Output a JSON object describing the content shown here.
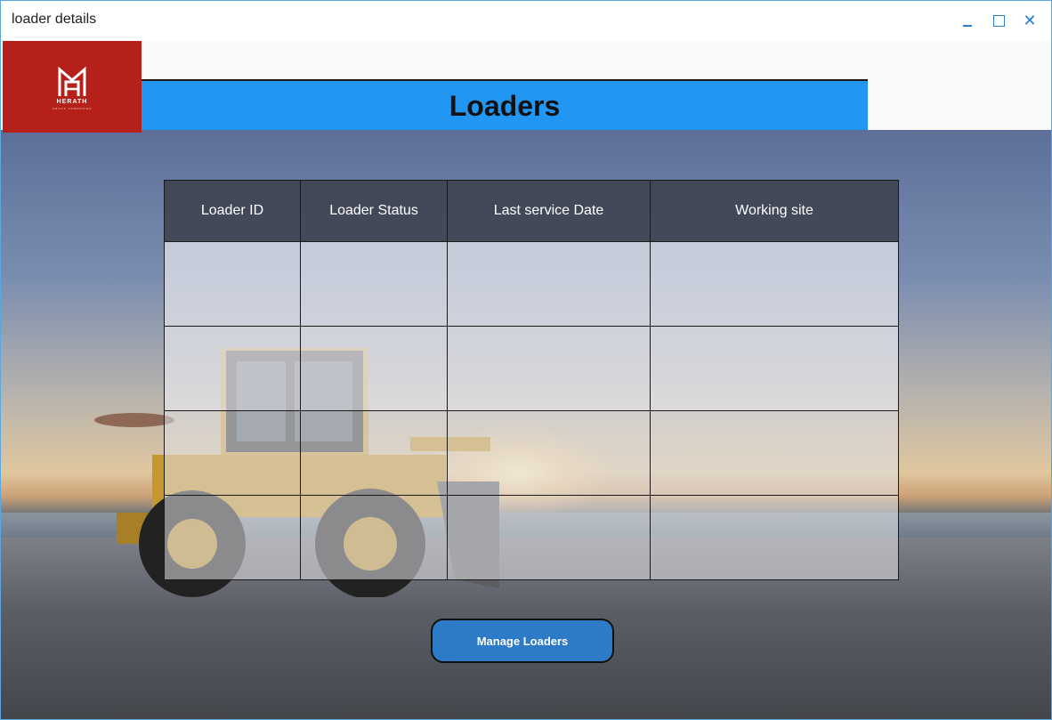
{
  "window": {
    "title": "loader details"
  },
  "logo": {
    "text": "HERATH",
    "subtext": "GROUP COMPANIES"
  },
  "header": {
    "title": "Loaders"
  },
  "table": {
    "columns": [
      "Loader ID",
      "Loader Status",
      "Last service Date",
      "Working site"
    ],
    "rows": [
      [
        "",
        "",
        "",
        ""
      ],
      [
        "",
        "",
        "",
        ""
      ],
      [
        "",
        "",
        "",
        ""
      ],
      [
        "",
        "",
        "",
        ""
      ]
    ]
  },
  "actions": {
    "manage_label": "Manage Loaders"
  },
  "colors": {
    "header_bar": "#2196f3",
    "logo_bg": "#b5201a",
    "button": "#2d7bc7",
    "table_header": "#3e4452"
  }
}
